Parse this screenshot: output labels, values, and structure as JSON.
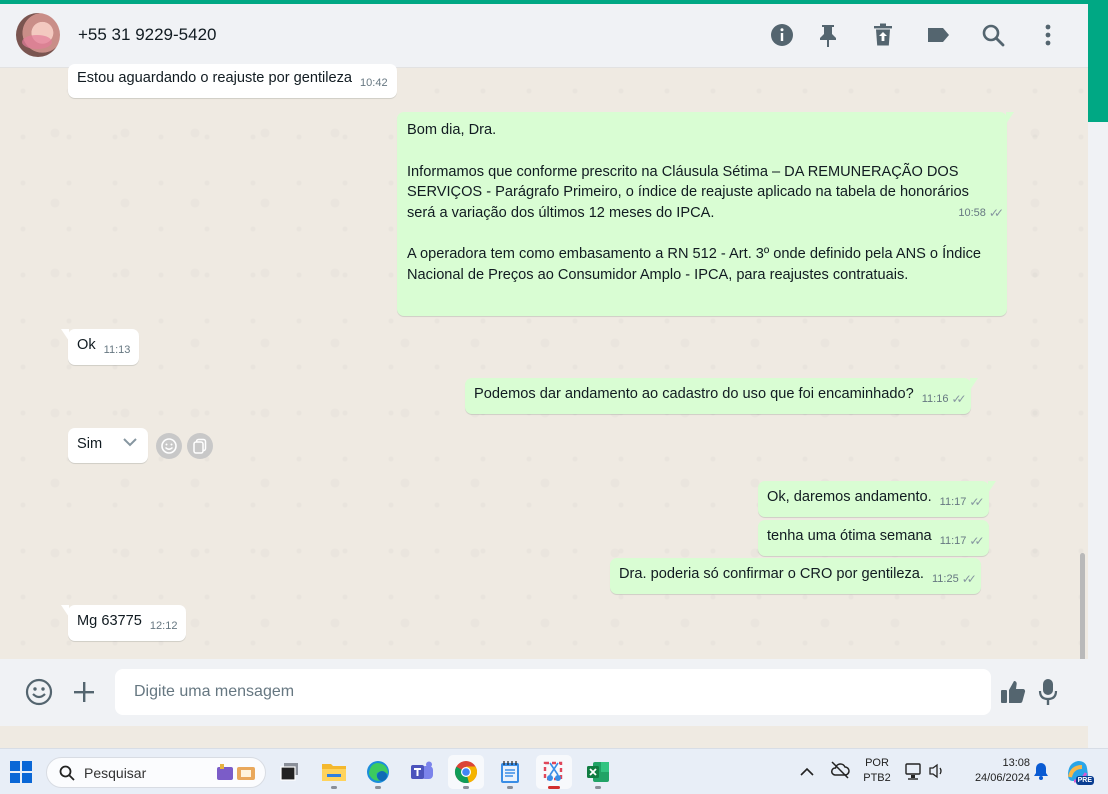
{
  "header": {
    "contact_name": "+55 31 9229-5420",
    "icons": [
      "info-icon",
      "pin-icon",
      "delete-icon",
      "label-icon",
      "search-icon",
      "menu-icon"
    ]
  },
  "messages": [
    {
      "id": "m1",
      "direction": "in",
      "text": "Estou aguardando o reajuste por gentileza",
      "time": "10:42"
    },
    {
      "id": "m2",
      "direction": "out",
      "paragraphs": [
        "Bom dia, Dra.",
        "Informamos que conforme prescrito na Cláusula Sétima – DA REMUNERAÇÃO DOS SERVIÇOS - Parágrafo Primeiro, o índice de reajuste aplicado na tabela de honorários será a variação dos últimos 12 meses do IPCA.",
        "A operadora tem como embasamento a RN 512 - Art. 3º onde definido pela ANS o Índice Nacional de Preços ao Consumidor Amplo - IPCA, para reajustes contratuais."
      ],
      "time": "10:58",
      "status": "read"
    },
    {
      "id": "m3",
      "direction": "in",
      "text": "Ok",
      "time": "11:13"
    },
    {
      "id": "m4",
      "direction": "out",
      "text": "Podemos dar andamento ao cadastro do uso que foi encaminhado?",
      "time": "11:16",
      "status": "read"
    },
    {
      "id": "m5",
      "direction": "in",
      "text": "Sim",
      "time": "",
      "hovered": true
    },
    {
      "id": "m6",
      "direction": "out",
      "text": "Ok, daremos andamento.",
      "time": "11:17",
      "status": "read"
    },
    {
      "id": "m7",
      "direction": "out",
      "text": "tenha uma ótima semana",
      "time": "11:17",
      "status": "read"
    },
    {
      "id": "m8",
      "direction": "out",
      "text": "Dra. poderia só confirmar o CRO por gentileza.",
      "time": "11:25",
      "status": "read"
    },
    {
      "id": "m9",
      "direction": "in",
      "text": "Mg 63775",
      "time": "12:12"
    }
  ],
  "composer": {
    "placeholder": "Digite uma mensagem",
    "icons": [
      "emoji-icon",
      "attach-plus-icon",
      "thumbs-up-icon",
      "microphone-icon"
    ]
  },
  "taskbar": {
    "search_label": "Pesquisar",
    "apps": [
      "task-view-icon",
      "file-explorer-icon",
      "edge-icon",
      "teams-icon",
      "chrome-icon",
      "notepad-icon",
      "snipping-tool-icon",
      "excel-icon"
    ],
    "active_app": "chrome-icon",
    "language_line1": "POR",
    "language_line2": "PTB2",
    "clock_time": "13:08",
    "clock_date": "24/06/2024",
    "copilot_badge": "PRE"
  },
  "colors": {
    "accent": "#00a884",
    "bubble_out": "#d9fdd3",
    "bubble_in": "#ffffff",
    "chat_bg": "#efeae2",
    "tick": "#8696a0"
  }
}
